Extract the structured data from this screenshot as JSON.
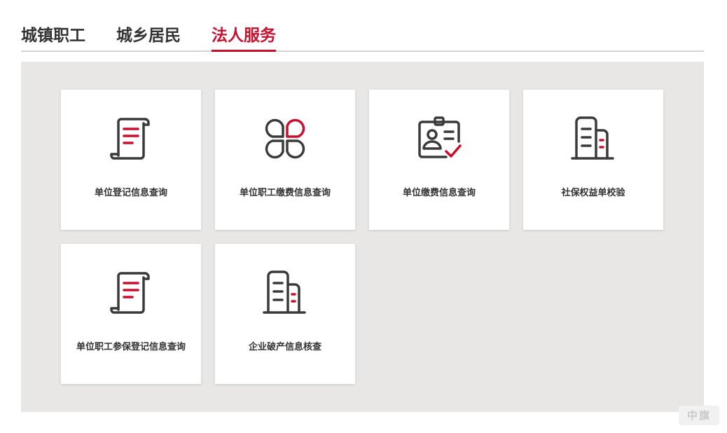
{
  "tabs": [
    {
      "label": "城镇职工",
      "active": false
    },
    {
      "label": "城乡居民",
      "active": false
    },
    {
      "label": "法人服务",
      "active": true
    }
  ],
  "colors": {
    "accent": "#c8102e",
    "icon_dark": "#3a3a3a",
    "panel_bg": "#e8e7e6",
    "text": "#333333"
  },
  "services": [
    {
      "label": "单位登记信息查询",
      "icon": "document-scroll-icon"
    },
    {
      "label": "单位职工缴费信息查询",
      "icon": "clover-icon"
    },
    {
      "label": "单位缴费信息查询",
      "icon": "id-badge-check-icon"
    },
    {
      "label": "社保权益单校验",
      "icon": "buildings-icon"
    },
    {
      "label": "单位职工参保登记信息查询",
      "icon": "document-scroll-icon"
    },
    {
      "label": "企业破产信息核查",
      "icon": "buildings-icon"
    }
  ],
  "watermark": "中旗"
}
